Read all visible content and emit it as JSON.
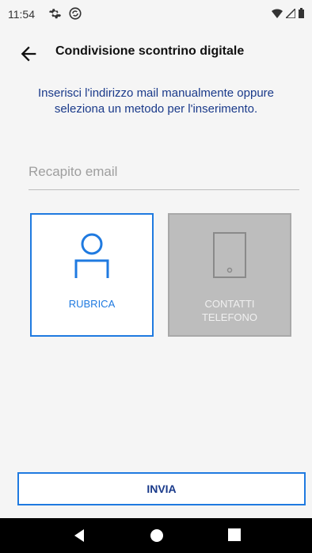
{
  "status_bar": {
    "time": "11:54",
    "icons_left": [
      "gear-icon",
      "sync-icon"
    ],
    "icons_right": [
      "wifi-icon",
      "signal-icon",
      "battery-icon"
    ]
  },
  "header": {
    "title": "Condivisione scontrino digitale",
    "back_icon": "arrow-left-icon"
  },
  "instruction": "Inserisci l'indirizzo mail manualmente oppure seleziona un metodo per l'inserimento.",
  "email_field": {
    "placeholder": "Recapito email",
    "value": ""
  },
  "tiles": [
    {
      "label": "RUBRICA",
      "icon": "person-icon",
      "enabled": true
    },
    {
      "label": "CONTATTI\nTELEFONO",
      "icon": "phone-icon",
      "enabled": false
    }
  ],
  "send_button": {
    "label": "INVIA"
  },
  "nav_bar": {
    "icons": [
      "back-triangle-icon",
      "home-circle-icon",
      "recents-square-icon"
    ]
  },
  "colors": {
    "accent": "#1f7ae0",
    "instruction_text": "#1a3a8a",
    "background": "#f5f5f5",
    "disabled_tile": "#bdbdbd",
    "nav_bar": "#000000"
  }
}
